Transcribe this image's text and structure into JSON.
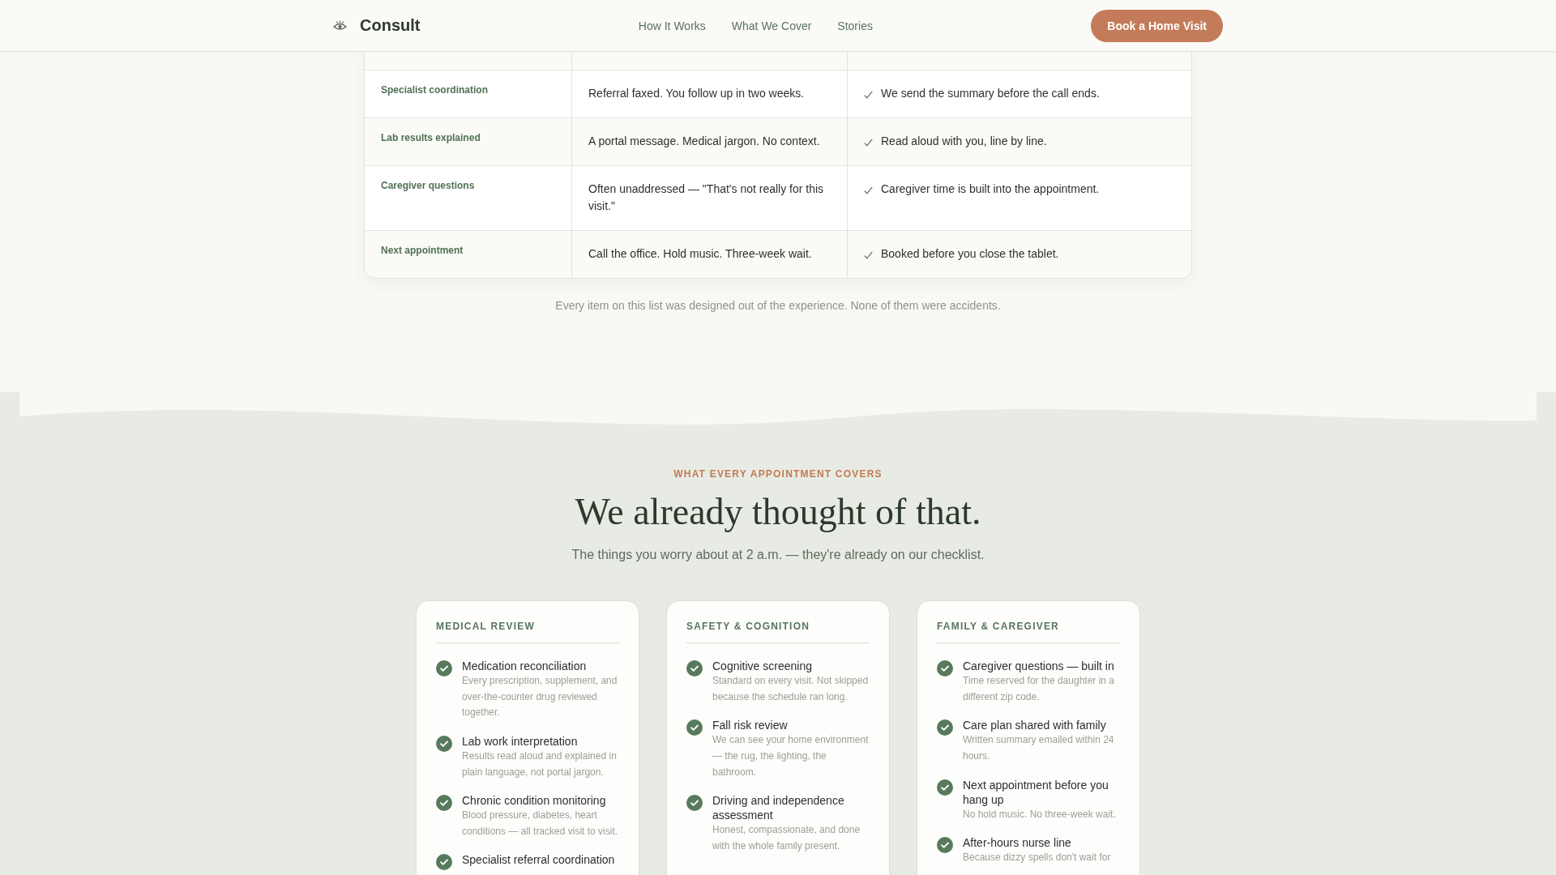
{
  "header": {
    "logo": "Consult",
    "nav": [
      {
        "label": "How It Works"
      },
      {
        "label": "What We Cover"
      },
      {
        "label": "Stories"
      }
    ],
    "cta": "Book a Home Visit"
  },
  "comparison": {
    "rows": [
      {
        "topic": "Specialist coordination",
        "typical": "Referral faxed. You follow up in two weeks.",
        "ours": "We send the summary before the call ends."
      },
      {
        "topic": "Lab results explained",
        "typical": "A portal message. Medical jargon. No context.",
        "ours": "Read aloud with you, line by line."
      },
      {
        "topic": "Caregiver questions",
        "typical": "Often unaddressed — \"That's not really for this visit.\"",
        "ours": "Caregiver time is built into the appointment."
      },
      {
        "topic": "Next appointment",
        "typical": "Call the office. Hold music. Three-week wait.",
        "ours": "Booked before you close the tablet."
      }
    ],
    "footnote": "Every item on this list was designed out of the experience. None of them were accidents."
  },
  "coverage": {
    "eyebrow": "WHAT EVERY APPOINTMENT COVERS",
    "title": "We already thought of that.",
    "subtitle": "The things you worry about at 2 a.m. — they're already on our checklist.",
    "cards": [
      {
        "title": "MEDICAL REVIEW",
        "items": [
          {
            "title": "Medication reconciliation",
            "description": "Every prescription, supplement, and over-the-counter drug reviewed together."
          },
          {
            "title": "Lab work interpretation",
            "description": "Results read aloud and explained in plain language, not portal jargon."
          },
          {
            "title": "Chronic condition monitoring",
            "description": "Blood pressure, diabetes, heart conditions — all tracked visit to visit."
          },
          {
            "title": "Specialist referral coordination"
          }
        ]
      },
      {
        "title": "SAFETY & COGNITION",
        "items": [
          {
            "title": "Cognitive screening",
            "description": "Standard on every visit. Not skipped because the schedule ran long."
          },
          {
            "title": "Fall risk review",
            "description": "We can see your home environment — the rug, the lighting, the bathroom."
          },
          {
            "title": "Driving and independence assessment",
            "description": "Honest, compassionate, and done with the whole family present."
          }
        ]
      },
      {
        "title": "FAMILY & CAREGIVER",
        "items": [
          {
            "title": "Caregiver questions — built in",
            "description": "Time reserved for the daughter in a different zip code."
          },
          {
            "title": "Care plan shared with family",
            "description": "Written summary emailed within 24 hours."
          },
          {
            "title": "Next appointment before you hang up",
            "description": "No hold music. No three-week wait."
          },
          {
            "title": "After-hours nurse line",
            "description": "Because dizzy spells don't wait for"
          }
        ]
      }
    ]
  }
}
